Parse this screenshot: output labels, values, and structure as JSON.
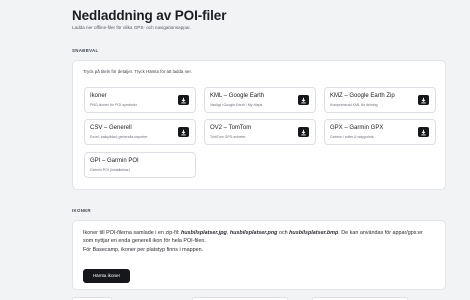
{
  "page": {
    "title": "Nedladdning av POI-filer",
    "subtitle": "Ladda ner offline-filer för olika GPS- och navigationsappar."
  },
  "selection": {
    "section_label": "SNABBVAL",
    "help_text": "Tryck på titeln för detaljer. Tryck Hämta för att ladda ner.",
    "tiles": [
      {
        "title": "Ikoner",
        "desc": "PNG-ikoner för POI-symboler"
      },
      {
        "title": "KML – Google Earth",
        "desc": "Vanligt i Google Earth / My Maps"
      },
      {
        "title": "KMZ – Google Earth Zip",
        "desc": "Komprimerad KML för delning"
      },
      {
        "title": "CSV – Generell",
        "desc": "Excel, kalkylblad, generella importer"
      },
      {
        "title": "OV2 – TomTom",
        "desc": "TomTom GPS-enheter"
      },
      {
        "title": "GPX – Garmin GPX",
        "desc": "Garmin / rutter & waypoints"
      },
      {
        "title": "GPI – Garmin POI",
        "desc": "Garmin POI (installerbar)"
      }
    ],
    "download_icon": "download-icon"
  },
  "icons_section": {
    "section_label": "IKONER",
    "text_before": "Ikoner till POI-filerna samlade i en zip-fil: ",
    "file1": "husbilsplatser.jpg",
    "sep1": ", ",
    "file2": "husbilsplatser.png",
    "sep2": " och ",
    "file3": "husbilsplatser.bmp",
    "text_after": ". De kan användas för appar/gps:er som nyttjar en enda generell ikon för hela POI-filen.",
    "line2": "För Basecamp, ikoner per platstyp finns i mappen.",
    "button_label": "Hämta ikoner"
  }
}
